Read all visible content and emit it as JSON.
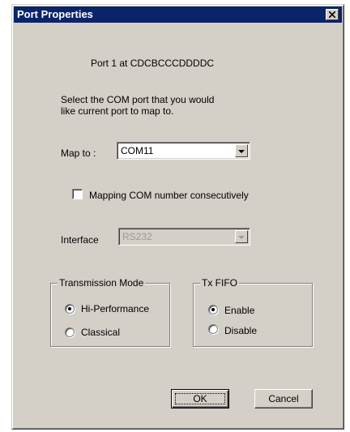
{
  "window": {
    "title": "Port Properties",
    "title_bar_color": "#0a246a",
    "close_icon": "close-icon"
  },
  "port_info": "Port 1 at CDCBCCCDDDDC",
  "instructions": {
    "line1": "Select the COM port that you would",
    "line2": "like current port to map to."
  },
  "map_to": {
    "label": "Map to :",
    "value": "COM11"
  },
  "mapping_consecutive": {
    "label": "Mapping COM number consecutively",
    "checked": false
  },
  "interface": {
    "label": "Interface",
    "value": "RS232",
    "disabled": true
  },
  "transmission_mode": {
    "title": "Transmission Mode",
    "options": [
      {
        "label": "Hi-Performance",
        "selected": true
      },
      {
        "label": "Classical",
        "selected": false
      }
    ]
  },
  "tx_fifo": {
    "title": "Tx FIFO",
    "options": [
      {
        "label": "Enable",
        "selected": true
      },
      {
        "label": "Disable",
        "selected": false
      }
    ]
  },
  "buttons": {
    "ok": "OK",
    "cancel": "Cancel"
  }
}
